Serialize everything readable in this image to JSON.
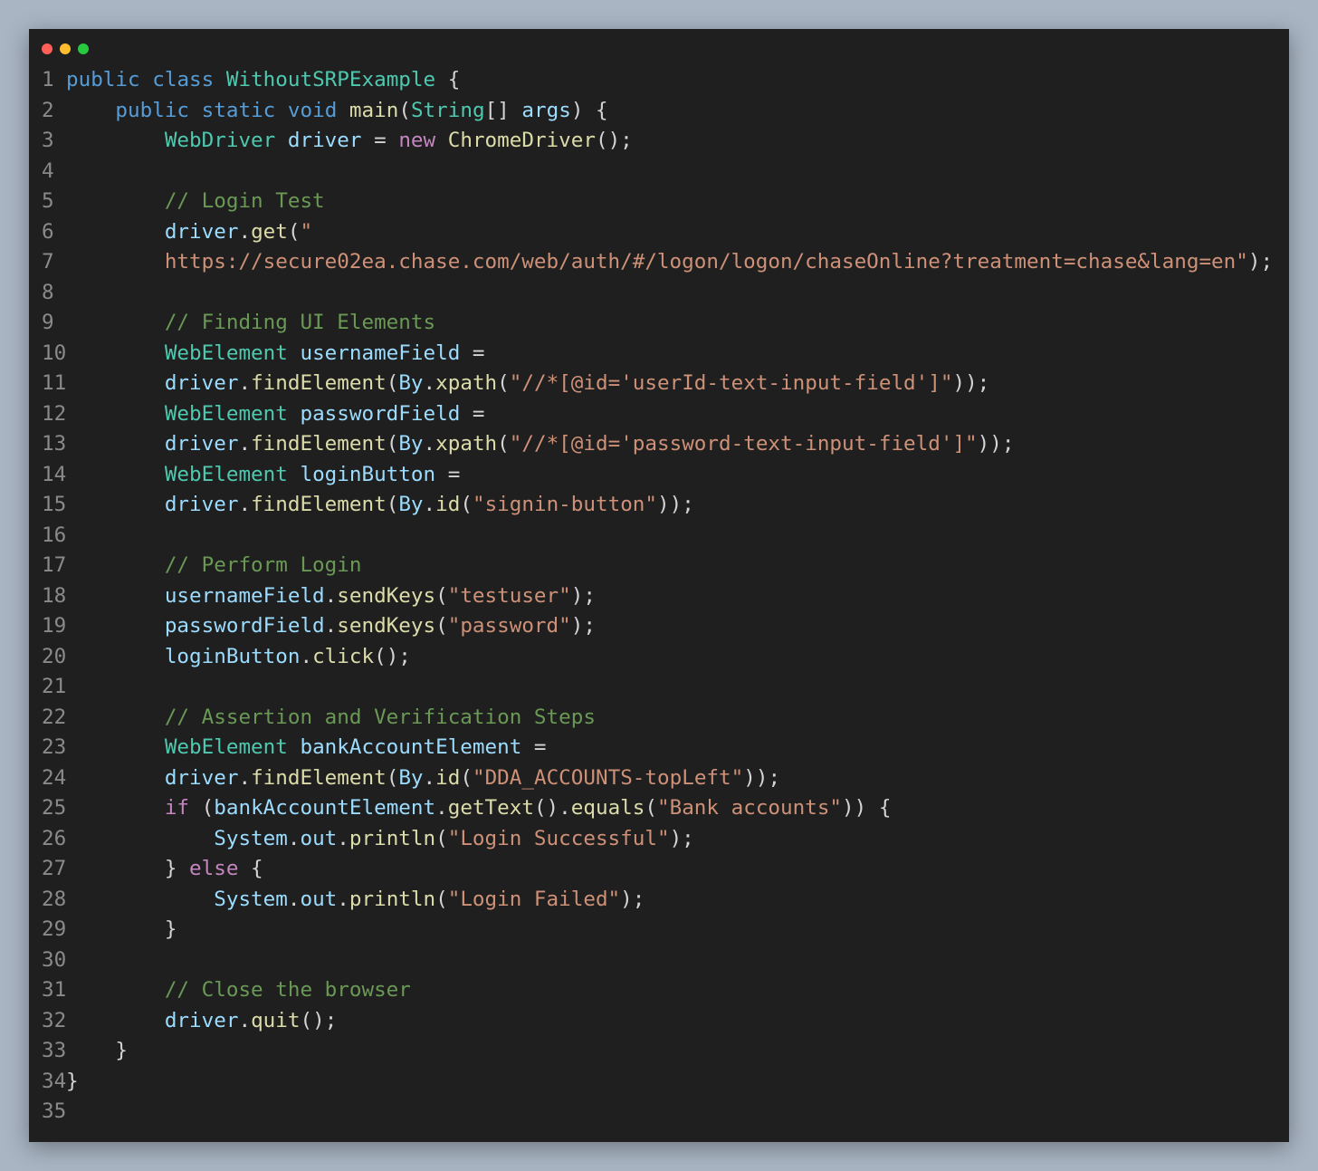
{
  "window": {
    "controls": {
      "close_color": "#ff5f57",
      "minimize_color": "#febc2e",
      "maximize_color": "#28c840"
    }
  },
  "editor": {
    "language": "java",
    "lines": [
      {
        "n": "1",
        "tokens": [
          [
            "kw",
            "public"
          ],
          [
            "pun",
            " "
          ],
          [
            "kw",
            "class"
          ],
          [
            "pun",
            " "
          ],
          [
            "ty",
            "WithoutSRPExample"
          ],
          [
            "pun",
            " {"
          ]
        ]
      },
      {
        "n": "2",
        "tokens": [
          [
            "pun",
            "    "
          ],
          [
            "kw",
            "public"
          ],
          [
            "pun",
            " "
          ],
          [
            "kw",
            "static"
          ],
          [
            "pun",
            " "
          ],
          [
            "kw",
            "void"
          ],
          [
            "pun",
            " "
          ],
          [
            "fn",
            "main"
          ],
          [
            "pun",
            "("
          ],
          [
            "ty",
            "String"
          ],
          [
            "pun",
            "[] "
          ],
          [
            "var",
            "args"
          ],
          [
            "pun",
            ") {"
          ]
        ]
      },
      {
        "n": "3",
        "tokens": [
          [
            "pun",
            "        "
          ],
          [
            "ty",
            "WebDriver"
          ],
          [
            "pun",
            " "
          ],
          [
            "var",
            "driver"
          ],
          [
            "pun",
            " = "
          ],
          [
            "ctl",
            "new"
          ],
          [
            "pun",
            " "
          ],
          [
            "fn",
            "ChromeDriver"
          ],
          [
            "pun",
            "();"
          ]
        ]
      },
      {
        "n": "4",
        "tokens": []
      },
      {
        "n": "5",
        "tokens": [
          [
            "pun",
            "        "
          ],
          [
            "com",
            "// Login Test"
          ]
        ]
      },
      {
        "n": "6",
        "tokens": [
          [
            "pun",
            "        "
          ],
          [
            "var",
            "driver"
          ],
          [
            "pun",
            "."
          ],
          [
            "fn",
            "get"
          ],
          [
            "pun",
            "("
          ],
          [
            "str",
            "\""
          ]
        ]
      },
      {
        "n": "7",
        "tokens": [
          [
            "pun",
            "        "
          ],
          [
            "str",
            "https://secure02ea.chase.com/web/auth/#/logon/logon/chaseOnline?treatment=chase&lang=en\""
          ],
          [
            "pun",
            ");"
          ]
        ]
      },
      {
        "n": "8",
        "tokens": []
      },
      {
        "n": "9",
        "tokens": [
          [
            "pun",
            "        "
          ],
          [
            "com",
            "// Finding UI Elements"
          ]
        ]
      },
      {
        "n": "10",
        "tokens": [
          [
            "pun",
            "        "
          ],
          [
            "ty",
            "WebElement"
          ],
          [
            "pun",
            " "
          ],
          [
            "var",
            "usernameField"
          ],
          [
            "pun",
            " ="
          ]
        ]
      },
      {
        "n": "11",
        "tokens": [
          [
            "pun",
            "        "
          ],
          [
            "var",
            "driver"
          ],
          [
            "pun",
            "."
          ],
          [
            "fn",
            "findElement"
          ],
          [
            "pun",
            "("
          ],
          [
            "var",
            "By"
          ],
          [
            "pun",
            "."
          ],
          [
            "fn",
            "xpath"
          ],
          [
            "pun",
            "("
          ],
          [
            "str",
            "\"//*[@id='userId-text-input-field']\""
          ],
          [
            "pun",
            "));"
          ]
        ]
      },
      {
        "n": "12",
        "tokens": [
          [
            "pun",
            "        "
          ],
          [
            "ty",
            "WebElement"
          ],
          [
            "pun",
            " "
          ],
          [
            "var",
            "passwordField"
          ],
          [
            "pun",
            " ="
          ]
        ]
      },
      {
        "n": "13",
        "tokens": [
          [
            "pun",
            "        "
          ],
          [
            "var",
            "driver"
          ],
          [
            "pun",
            "."
          ],
          [
            "fn",
            "findElement"
          ],
          [
            "pun",
            "("
          ],
          [
            "var",
            "By"
          ],
          [
            "pun",
            "."
          ],
          [
            "fn",
            "xpath"
          ],
          [
            "pun",
            "("
          ],
          [
            "str",
            "\"//*[@id='password-text-input-field']\""
          ],
          [
            "pun",
            "));"
          ]
        ]
      },
      {
        "n": "14",
        "tokens": [
          [
            "pun",
            "        "
          ],
          [
            "ty",
            "WebElement"
          ],
          [
            "pun",
            " "
          ],
          [
            "var",
            "loginButton"
          ],
          [
            "pun",
            " ="
          ]
        ]
      },
      {
        "n": "15",
        "tokens": [
          [
            "pun",
            "        "
          ],
          [
            "var",
            "driver"
          ],
          [
            "pun",
            "."
          ],
          [
            "fn",
            "findElement"
          ],
          [
            "pun",
            "("
          ],
          [
            "var",
            "By"
          ],
          [
            "pun",
            "."
          ],
          [
            "fn",
            "id"
          ],
          [
            "pun",
            "("
          ],
          [
            "str",
            "\"signin-button\""
          ],
          [
            "pun",
            "));"
          ]
        ]
      },
      {
        "n": "16",
        "tokens": []
      },
      {
        "n": "17",
        "tokens": [
          [
            "pun",
            "        "
          ],
          [
            "com",
            "// Perform Login"
          ]
        ]
      },
      {
        "n": "18",
        "tokens": [
          [
            "pun",
            "        "
          ],
          [
            "var",
            "usernameField"
          ],
          [
            "pun",
            "."
          ],
          [
            "fn",
            "sendKeys"
          ],
          [
            "pun",
            "("
          ],
          [
            "str",
            "\"testuser\""
          ],
          [
            "pun",
            ");"
          ]
        ]
      },
      {
        "n": "19",
        "tokens": [
          [
            "pun",
            "        "
          ],
          [
            "var",
            "passwordField"
          ],
          [
            "pun",
            "."
          ],
          [
            "fn",
            "sendKeys"
          ],
          [
            "pun",
            "("
          ],
          [
            "str",
            "\"password\""
          ],
          [
            "pun",
            ");"
          ]
        ]
      },
      {
        "n": "20",
        "tokens": [
          [
            "pun",
            "        "
          ],
          [
            "var",
            "loginButton"
          ],
          [
            "pun",
            "."
          ],
          [
            "fn",
            "click"
          ],
          [
            "pun",
            "();"
          ]
        ]
      },
      {
        "n": "21",
        "tokens": []
      },
      {
        "n": "22",
        "tokens": [
          [
            "pun",
            "        "
          ],
          [
            "com",
            "// Assertion and Verification Steps"
          ]
        ]
      },
      {
        "n": "23",
        "tokens": [
          [
            "pun",
            "        "
          ],
          [
            "ty",
            "WebElement"
          ],
          [
            "pun",
            " "
          ],
          [
            "var",
            "bankAccountElement"
          ],
          [
            "pun",
            " ="
          ]
        ]
      },
      {
        "n": "24",
        "tokens": [
          [
            "pun",
            "        "
          ],
          [
            "var",
            "driver"
          ],
          [
            "pun",
            "."
          ],
          [
            "fn",
            "findElement"
          ],
          [
            "pun",
            "("
          ],
          [
            "var",
            "By"
          ],
          [
            "pun",
            "."
          ],
          [
            "fn",
            "id"
          ],
          [
            "pun",
            "("
          ],
          [
            "str",
            "\"DDA_ACCOUNTS-topLeft\""
          ],
          [
            "pun",
            "));"
          ]
        ]
      },
      {
        "n": "25",
        "tokens": [
          [
            "pun",
            "        "
          ],
          [
            "ctl",
            "if"
          ],
          [
            "pun",
            " ("
          ],
          [
            "var",
            "bankAccountElement"
          ],
          [
            "pun",
            "."
          ],
          [
            "fn",
            "getText"
          ],
          [
            "pun",
            "()."
          ],
          [
            "fn",
            "equals"
          ],
          [
            "pun",
            "("
          ],
          [
            "str",
            "\"Bank accounts\""
          ],
          [
            "pun",
            ")) {"
          ]
        ]
      },
      {
        "n": "26",
        "tokens": [
          [
            "pun",
            "            "
          ],
          [
            "var",
            "System"
          ],
          [
            "pun",
            "."
          ],
          [
            "var",
            "out"
          ],
          [
            "pun",
            "."
          ],
          [
            "fn",
            "println"
          ],
          [
            "pun",
            "("
          ],
          [
            "str",
            "\"Login Successful\""
          ],
          [
            "pun",
            ");"
          ]
        ]
      },
      {
        "n": "27",
        "tokens": [
          [
            "pun",
            "        } "
          ],
          [
            "ctl",
            "else"
          ],
          [
            "pun",
            " {"
          ]
        ]
      },
      {
        "n": "28",
        "tokens": [
          [
            "pun",
            "            "
          ],
          [
            "var",
            "System"
          ],
          [
            "pun",
            "."
          ],
          [
            "var",
            "out"
          ],
          [
            "pun",
            "."
          ],
          [
            "fn",
            "println"
          ],
          [
            "pun",
            "("
          ],
          [
            "str",
            "\"Login Failed\""
          ],
          [
            "pun",
            ");"
          ]
        ]
      },
      {
        "n": "29",
        "tokens": [
          [
            "pun",
            "        }"
          ]
        ]
      },
      {
        "n": "30",
        "tokens": []
      },
      {
        "n": "31",
        "tokens": [
          [
            "pun",
            "        "
          ],
          [
            "com",
            "// Close the browser"
          ]
        ]
      },
      {
        "n": "32",
        "tokens": [
          [
            "pun",
            "        "
          ],
          [
            "var",
            "driver"
          ],
          [
            "pun",
            "."
          ],
          [
            "fn",
            "quit"
          ],
          [
            "pun",
            "();"
          ]
        ]
      },
      {
        "n": "33",
        "tokens": [
          [
            "pun",
            "    }"
          ]
        ]
      },
      {
        "n": "34",
        "tokens": [
          [
            "pun",
            "}"
          ]
        ]
      },
      {
        "n": "35",
        "tokens": []
      }
    ]
  }
}
